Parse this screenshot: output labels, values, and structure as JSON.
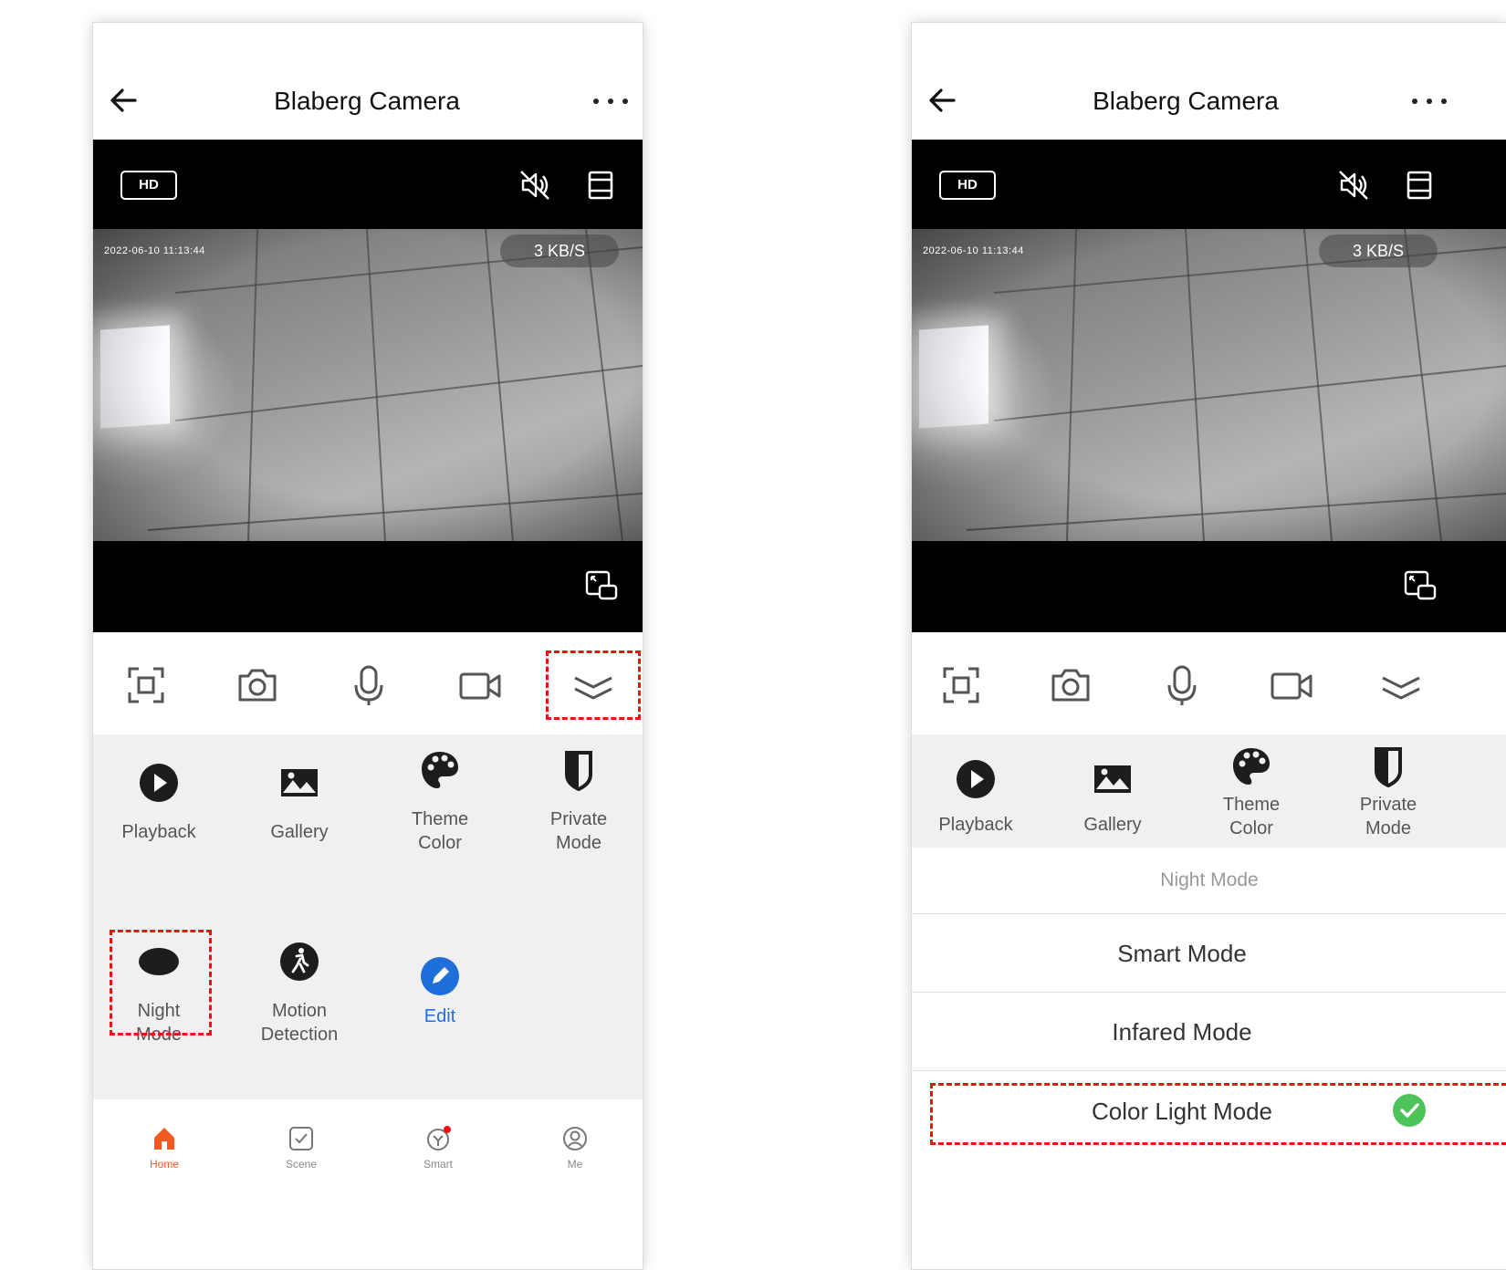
{
  "left_screen": {
    "header": {
      "title": "Blaberg Camera"
    },
    "video": {
      "quality_badge": "HD",
      "timestamp": "2022-06-10  11:13:44",
      "bitrate": "3 KB/S"
    },
    "features": [
      {
        "label": "Playback",
        "icon": "play-circle-icon"
      },
      {
        "label": "Gallery",
        "icon": "gallery-icon"
      },
      {
        "label": "Theme\nColor",
        "icon": "palette-icon"
      },
      {
        "label": "Private\nMode",
        "icon": "shield-icon"
      },
      {
        "label": "Night\nMode",
        "icon": "moon-eye-icon"
      },
      {
        "label": "Motion\nDetection",
        "icon": "motion-icon"
      },
      {
        "label": "Edit",
        "icon": "edit-icon"
      }
    ],
    "tabbar": {
      "tabs": [
        {
          "label": "Home",
          "icon": "home-icon",
          "active": true
        },
        {
          "label": "Scene",
          "icon": "scene-icon"
        },
        {
          "label": "Smart",
          "icon": "smart-icon"
        },
        {
          "label": "Me",
          "icon": "profile-icon"
        }
      ]
    }
  },
  "right_screen": {
    "header": {
      "title": "Blaberg Camera"
    },
    "video": {
      "quality_badge": "HD",
      "timestamp": "2022-06-10  11:13:44",
      "bitrate": "3 KB/S"
    },
    "features": [
      {
        "label": "Playback",
        "icon": "play-circle-icon"
      },
      {
        "label": "Gallery",
        "icon": "gallery-icon"
      },
      {
        "label": "Theme\nColor",
        "icon": "palette-icon"
      },
      {
        "label": "Private\nMode",
        "icon": "shield-icon"
      }
    ],
    "night_mode_sheet": {
      "title": "Night Mode",
      "options": [
        {
          "label": "Smart Mode",
          "selected": false
        },
        {
          "label": "Infared Mode",
          "selected": false
        },
        {
          "label": "Color Light Mode",
          "selected": true
        }
      ]
    }
  },
  "colors": {
    "accent": "#f25a1f",
    "edit_blue": "#1e6fd9",
    "check_green": "#4cc45a",
    "highlight_red": "#e11111"
  }
}
